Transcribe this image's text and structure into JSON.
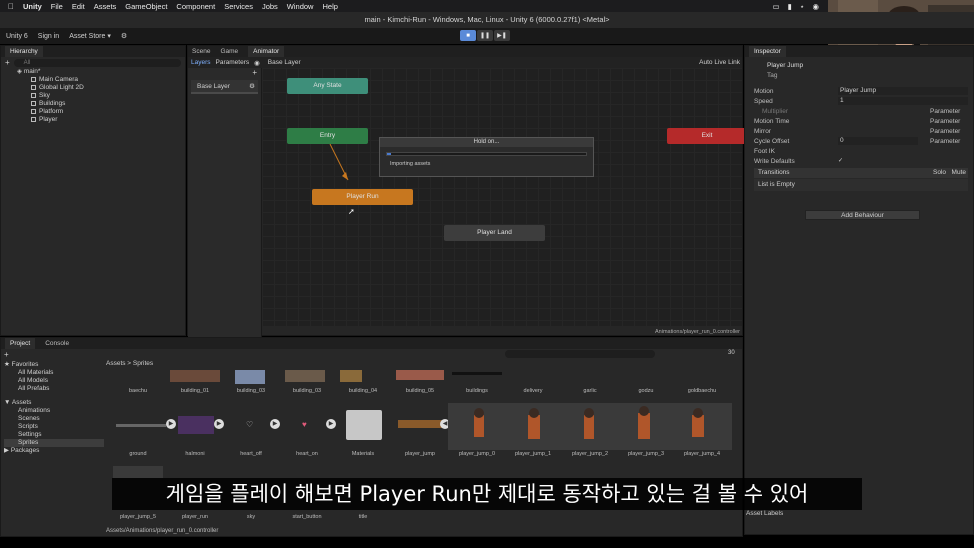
{
  "menubar": {
    "app": "Unity",
    "items": [
      "File",
      "Edit",
      "Assets",
      "GameObject",
      "Component",
      "Services",
      "Jobs",
      "Window",
      "Help"
    ]
  },
  "window": {
    "title": "main - Kimchi-Run - Windows, Mac, Linux - Unity 6 (6000.0.27f1) <Metal>"
  },
  "toolbar": {
    "account": "Unity 6",
    "signin": "Sign in",
    "asset_store": "Asset Store ▾"
  },
  "hierarchy": {
    "tab": "Hierarchy",
    "search_placeholder": "All",
    "scene": "main*",
    "items": [
      "Main Camera",
      "Global Light 2D",
      "Sky",
      "Buildings",
      "Platform",
      "Player"
    ]
  },
  "center_tabs": [
    "Scene",
    "Game",
    "Animator"
  ],
  "animator": {
    "subtabs": [
      "Layers",
      "Parameters"
    ],
    "breadcrumb": "Base Layer",
    "auto_live_link": "Auto Live Link",
    "layer": "Base Layer",
    "states": {
      "any": "Any State",
      "entry": "Entry",
      "exit": "Exit",
      "run": "Player Run",
      "land": "Player Land"
    },
    "path": "Animations/player_run_0.controller"
  },
  "modal": {
    "title": "Hold on...",
    "message": "Importing assets",
    "progress": 0.02
  },
  "inspector": {
    "tab": "Inspector",
    "name": "Player Jump",
    "tag_label": "Tag",
    "fields": {
      "motion_label": "Motion",
      "motion_value": "Player Jump",
      "speed_label": "Speed",
      "speed_value": "1",
      "multiplier_label": "Multiplier",
      "motion_time_label": "Motion Time",
      "mirror_label": "Mirror",
      "cycle_offset_label": "Cycle Offset",
      "cycle_offset_value": "0",
      "foot_ik_label": "Foot IK",
      "write_defaults_label": "Write Defaults",
      "parameter": "Parameter"
    },
    "transitions_label": "Transitions",
    "solo": "Solo",
    "mute": "Mute",
    "list_empty": "List is Empty",
    "add_behaviour": "Add Behaviour",
    "asset_labels": "Asset Labels"
  },
  "project": {
    "tabs": [
      "Project",
      "Console"
    ],
    "favorites": "Favorites",
    "fav_items": [
      "All Materials",
      "All Models",
      "All Prefabs"
    ],
    "assets": "Assets",
    "asset_folders": [
      "Animations",
      "Scenes",
      "Scripts",
      "Settings",
      "Sprites"
    ],
    "packages": "Packages",
    "breadcrumb": "Assets > Sprites",
    "slider_value": "30",
    "row1": [
      "baechu",
      "building_01",
      "building_03",
      "building_03",
      "building_04",
      "building_05",
      "buildings",
      "delivery",
      "garlic",
      "godzu",
      "goldbaechu"
    ],
    "row2": [
      "ground",
      "halmoni",
      "heart_off",
      "heart_on",
      "Materials",
      "player_jump",
      "player_jump_0",
      "player_jump_1",
      "player_jump_2",
      "player_jump_3",
      "player_jump_4"
    ],
    "row3": [
      "player_jump_5",
      "player_run",
      "sky",
      "start_button",
      "title"
    ],
    "footer_path": "Assets/Animations/player_run_0.controller"
  },
  "subtitle": "게임을 플레이 해보면 Player Run만 제대로 동작하고 있는 걸 볼 수 있어",
  "colors": {
    "any_state": "#3e8f7a",
    "entry": "#2e7d46",
    "exit": "#b52a2a",
    "run": "#c7771f",
    "land": "#3d3d3d",
    "accent": "#4a7bd0"
  }
}
